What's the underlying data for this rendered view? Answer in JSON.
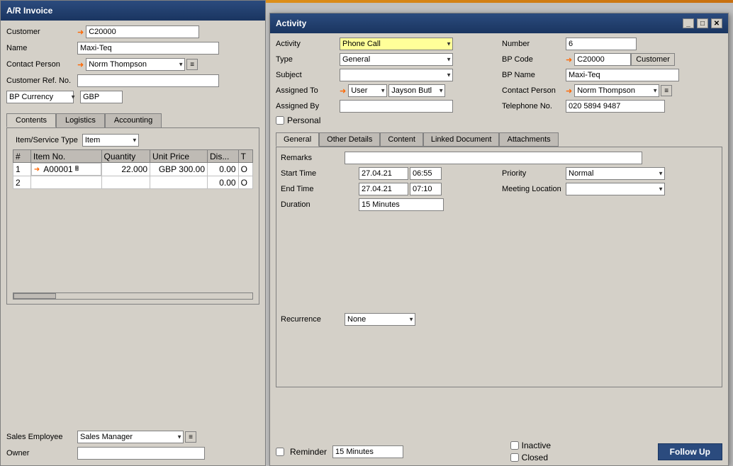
{
  "ar_invoice": {
    "title": "A/R Invoice",
    "fields": {
      "customer_label": "Customer",
      "customer_value": "C20000",
      "name_label": "Name",
      "name_value": "Maxi-Teq",
      "contact_person_label": "Contact Person",
      "contact_person_value": "Norm Thompson",
      "customer_ref_label": "Customer Ref. No.",
      "customer_ref_value": "",
      "bp_currency_label": "BP Currency",
      "bp_currency_value": "GBP"
    },
    "tabs": {
      "contents": "Contents",
      "logistics": "Logistics",
      "accounting": "Accounting"
    },
    "item_service_type_label": "Item/Service Type",
    "item_type_value": "Item",
    "table": {
      "headers": [
        "#",
        "Item No.",
        "Quantity",
        "Unit Price",
        "Dis...",
        "T"
      ],
      "rows": [
        {
          "num": "1",
          "item_no": "A00001",
          "quantity": "22.000",
          "unit_price": "GBP 300.00",
          "discount": "0.00",
          "t": "O"
        },
        {
          "num": "2",
          "item_no": "",
          "quantity": "",
          "unit_price": "",
          "discount": "0.00",
          "t": "O"
        }
      ]
    },
    "bottom": {
      "sales_employee_label": "Sales Employee",
      "sales_employee_value": "Sales Manager",
      "owner_label": "Owner",
      "owner_value": ""
    }
  },
  "activity": {
    "title": "Activity",
    "controls": {
      "minimize": "_",
      "maximize": "□",
      "close": "✕"
    },
    "fields": {
      "activity_label": "Activity",
      "activity_value": "Phone Call",
      "number_label": "Number",
      "number_value": "6",
      "type_label": "Type",
      "type_value": "General",
      "bp_code_label": "BP Code",
      "bp_code_value": "C20000",
      "customer_btn": "Customer",
      "subject_label": "Subject",
      "subject_value": "",
      "bp_name_label": "BP Name",
      "bp_name_value": "Maxi-Teq",
      "assigned_to_label": "Assigned To",
      "user_value": "User",
      "jayson_value": "Jayson Butl",
      "contact_person_label": "Contact Person",
      "contact_person_value": "Norm Thompson",
      "assigned_by_label": "Assigned By",
      "assigned_by_value": "",
      "telephone_label": "Telephone No.",
      "telephone_value": "020 5894 9487",
      "personal_label": "Personal"
    },
    "tabs": {
      "general": "General",
      "other_details": "Other Details",
      "content": "Content",
      "linked_document": "Linked Document",
      "attachments": "Attachments"
    },
    "general_tab": {
      "remarks_label": "Remarks",
      "remarks_value": "",
      "start_time_label": "Start Time",
      "start_date": "27.04.21",
      "start_time": "06:55",
      "priority_label": "Priority",
      "priority_value": "Normal",
      "end_time_label": "End Time",
      "end_date": "27.04.21",
      "end_time": "07:10",
      "meeting_location_label": "Meeting Location",
      "meeting_location_value": "",
      "duration_label": "Duration",
      "duration_value": "15 Minutes",
      "recurrence_label": "Recurrence",
      "recurrence_value": "None"
    },
    "bottom": {
      "reminder_label": "Reminder",
      "reminder_value": "15 Minutes",
      "inactive_label": "Inactive",
      "closed_label": "Closed",
      "follow_up_btn": "Follow Up"
    }
  }
}
